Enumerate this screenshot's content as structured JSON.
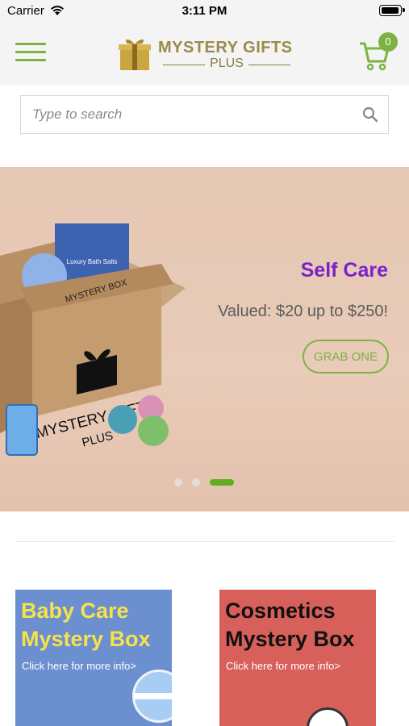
{
  "status_bar": {
    "carrier": "Carrier",
    "time": "3:11 PM"
  },
  "header": {
    "logo_title": "MYSTERY GIFTS",
    "logo_subtitle": "PLUS",
    "cart_count": "0"
  },
  "search": {
    "placeholder": "Type to search"
  },
  "slider": {
    "slide_title": "Self Care",
    "slide_subtitle": "Valued: $20 up to $250!",
    "button_label": "GRAB ONE",
    "box_label_top": "MYSTERY BOX",
    "box_label_brand": "MYSTERY GIFTS",
    "box_label_plus": "PLUS",
    "bath_salts_label": "Luxury Bath Salts",
    "dots_total": 3,
    "active_dot": 3
  },
  "cards": [
    {
      "title_line1": "Baby Care",
      "title_line2": "Mystery Box",
      "info": "Click here for more info>"
    },
    {
      "title_line1": "Cosmetics",
      "title_line2": "Mystery Box",
      "info": "Click here for more info>"
    }
  ],
  "colors": {
    "accent_green": "#7cb342",
    "slide_title_purple": "#7b22c9",
    "baby_card": "#6c8fcf",
    "cosmetics_card": "#d8605a"
  }
}
